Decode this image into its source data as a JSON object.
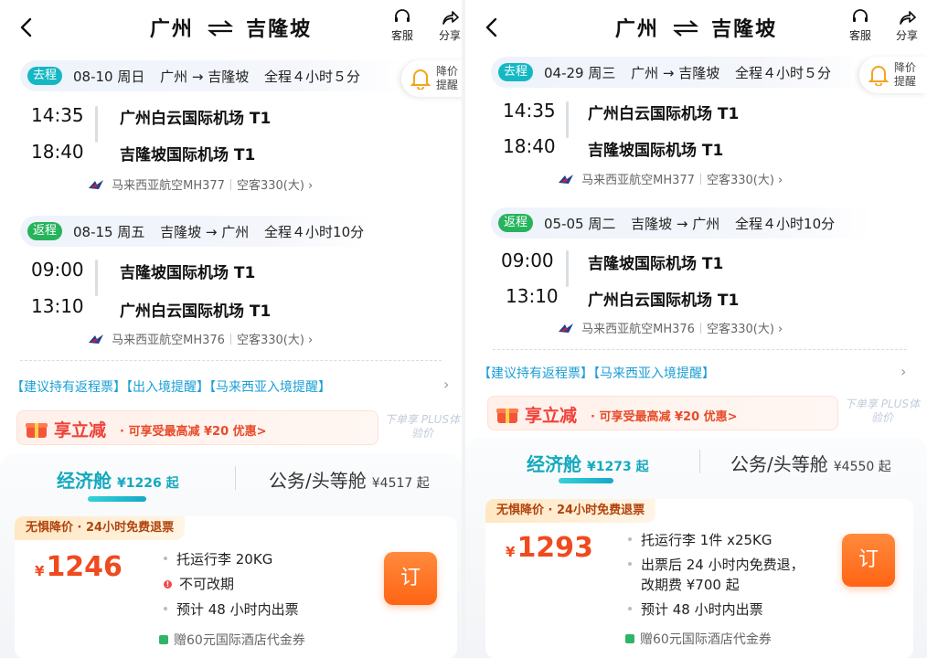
{
  "left": {
    "header": {
      "from": "广州",
      "to": "吉隆坡",
      "service": "客服",
      "share": "分享"
    },
    "outbound": {
      "tag": "去程",
      "date": "08-10 周日",
      "route": "广州 → 吉隆坡",
      "duration": "全程４小时５分",
      "dep_time": "14:35",
      "dep_airport": "广州白云国际机场 T1",
      "arr_time": "18:40",
      "arr_airport": "吉隆坡国际机场 T1",
      "airline": "马来西亚航空MH377",
      "aircraft": "空客330(大)"
    },
    "remind": "降价提醒",
    "inbound": {
      "tag": "返程",
      "date": "08-15 周五",
      "route": "吉隆坡 → 广州",
      "duration": "全程４小时10分",
      "dep_time": "09:00",
      "dep_airport": "吉隆坡国际机场 T1",
      "arr_time": "13:10",
      "arr_airport": "广州白云国际机场 T1",
      "airline": "马来西亚航空MH376",
      "aircraft": "空客330(大)"
    },
    "notes": "【建议持有返程票】【出入境提醒】【马来西亚入境提醒】",
    "promo": {
      "big": "享立减",
      "small": "· 可享受最高减 ¥20 优惠>",
      "plus": "下单享 PLUS体验价"
    },
    "cabins": {
      "economy": {
        "label": "经济舱",
        "price": "¥1226 起"
      },
      "business": {
        "label": "公务/头等舱",
        "price": "¥4517 起"
      }
    },
    "fare": {
      "badge": "无惧降价 · 24小时免费退票",
      "currency": "¥",
      "price": "1246",
      "f1": "托运行李 20KG",
      "f2": "不可改期",
      "f3": "预计 48 小时内出票",
      "book": "订",
      "gift": "赠60元国际酒店代金券"
    }
  },
  "right": {
    "header": {
      "from": "广州",
      "to": "吉隆坡",
      "service": "客服",
      "share": "分享"
    },
    "outbound": {
      "tag": "去程",
      "date": "04-29 周三",
      "route": "广州 → 吉隆坡",
      "duration": "全程４小时５分",
      "dep_time": "14:35",
      "dep_airport": "广州白云国际机场 T1",
      "arr_time": "18:40",
      "arr_airport": "吉隆坡国际机场 T1",
      "airline": "马来西亚航空MH377",
      "aircraft": "空客330(大)"
    },
    "remind": "降价提醒",
    "inbound": {
      "tag": "返程",
      "date": "05-05 周二",
      "route": "吉隆坡 → 广州",
      "duration": "全程４小时10分",
      "dep_time": "09:00",
      "dep_airport": "吉隆坡国际机场 T1",
      "arr_time": "13:10",
      "arr_airport": "广州白云国际机场 T1",
      "airline": "马来西亚航空MH376",
      "aircraft": "空客330(大)"
    },
    "notes": "【建议持有返程票】【马来西亚入境提醒】",
    "promo": {
      "big": "享立减",
      "small": "· 可享受最高减 ¥20 优惠>",
      "plus": "下单享 PLUS体验价"
    },
    "cabins": {
      "economy": {
        "label": "经济舱",
        "price": "¥1273 起"
      },
      "business": {
        "label": "公务/头等舱",
        "price": "¥4550 起"
      }
    },
    "fare": {
      "badge": "无惧降价 · 24小时免费退票",
      "currency": "¥",
      "price": "1293",
      "f1": "托运行李 1件 x25KG",
      "f2": "出票后 24 小时内免费退，",
      "f2b": "改期费 ¥700 起",
      "f3": "预计 48 小时内出票",
      "book": "订",
      "gift": "赠60元国际酒店代金券"
    }
  },
  "colors": {
    "accent": "#13a9be",
    "tag_outbound": "#14b8c4",
    "tag_return": "#27b35b",
    "price": "#f04a1f",
    "notes": "#1a9fd6",
    "book_button": "#ff6e20"
  },
  "icons": {
    "back": "chevron-left-icon",
    "service": "headset-icon",
    "share": "share-arrow-icon",
    "remind": "bell-icon",
    "airline": "malaysia-airlines-logo-icon",
    "swap": "swap-arrows-icon",
    "promo": "gift-icon",
    "warning": "warning-icon",
    "hotel": "hotel-voucher-icon"
  }
}
